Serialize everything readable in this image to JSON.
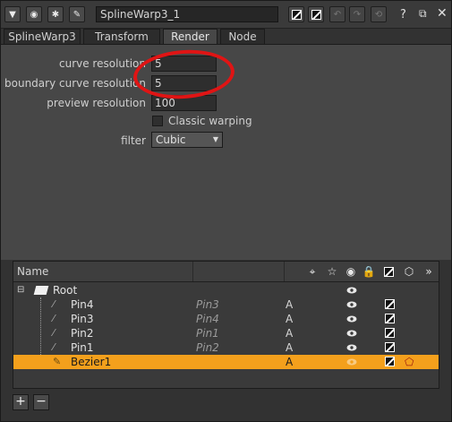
{
  "window": {
    "node_name": "SplineWarp3_1",
    "help_glyph": "?",
    "buttons": [
      "collapse",
      "center",
      "bug",
      "wrench",
      "color-a",
      "color-b",
      "undo",
      "redo",
      "revert",
      "help",
      "float",
      "close"
    ]
  },
  "tabs": [
    {
      "label": "SplineWarp3",
      "active": false
    },
    {
      "label": "Transform",
      "active": false
    },
    {
      "label": "Render",
      "active": true
    },
    {
      "label": "Node",
      "active": false
    }
  ],
  "render": {
    "curve_resolution_label": "curve resolution",
    "curve_resolution_value": "5",
    "boundary_curve_resolution_label": "boundary curve resolution",
    "boundary_curve_resolution_value": "5",
    "preview_resolution_label": "preview resolution",
    "preview_resolution_value": "100",
    "classic_warping_label": "Classic warping",
    "classic_warping_checked": false,
    "filter_label": "filter",
    "filter_value": "Cubic"
  },
  "curves": {
    "header_name": "Name",
    "header_icons": [
      "crosshair-icon",
      "star-icon",
      "eye-icon",
      "lock-icon",
      "color-swatch-icon",
      "hexagon-icon",
      "motion-blur-icon"
    ],
    "root_label": "Root",
    "rows": [
      {
        "name": "Pin4",
        "joined": "Pin3",
        "src": "A",
        "selected": false
      },
      {
        "name": "Pin3",
        "joined": "Pin4",
        "src": "A",
        "selected": false
      },
      {
        "name": "Pin2",
        "joined": "Pin1",
        "src": "A",
        "selected": false
      },
      {
        "name": "Pin1",
        "joined": "Pin2",
        "src": "A",
        "selected": false
      },
      {
        "name": "Bezier1",
        "joined": "",
        "src": "A",
        "selected": true
      }
    ]
  },
  "bottom_buttons": {
    "add": "+",
    "remove": "−"
  },
  "colors": {
    "selection": "#f4a01c",
    "annotation": "#e01414",
    "panel": "#474747",
    "background": "#323232"
  }
}
